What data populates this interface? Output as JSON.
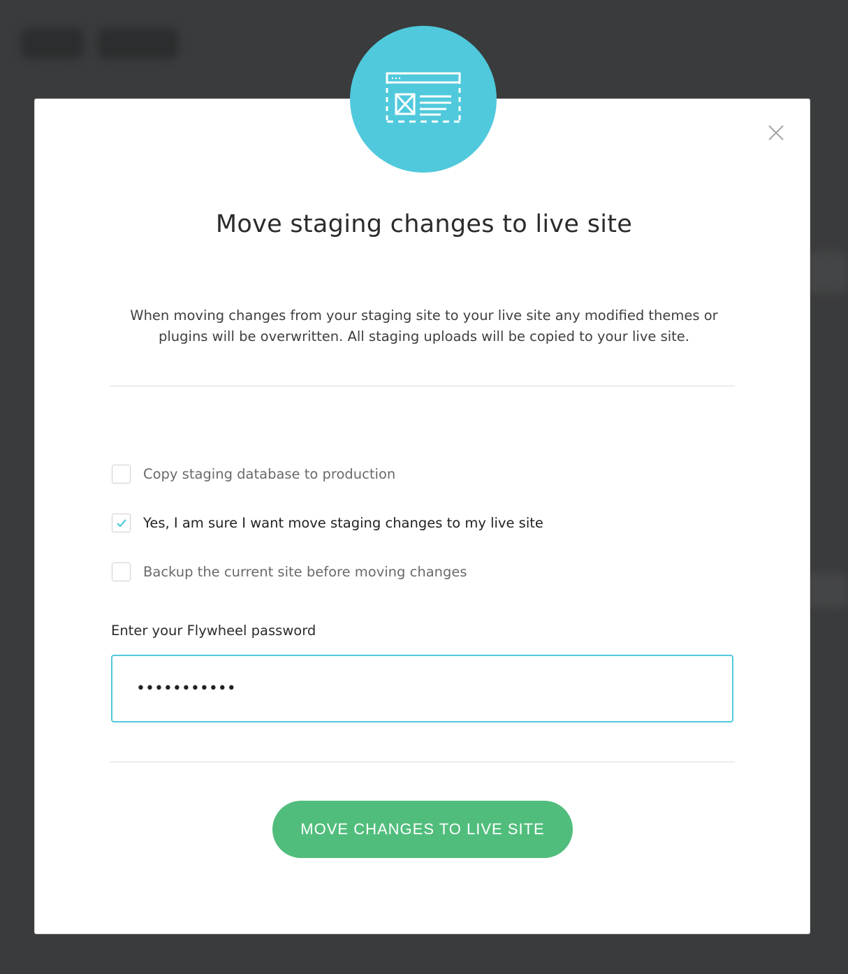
{
  "dialog": {
    "title": "Move staging changes to live site",
    "description": "When moving changes from your staging site to your live site any modified themes or plugins will be overwritten. All staging uploads will be copied to your live site.",
    "icon": "website-layout-icon",
    "close_icon": "close-icon"
  },
  "options": [
    {
      "label": "Copy staging database to production",
      "checked": false
    },
    {
      "label": "Yes, I am sure I want move staging changes to my live site",
      "checked": true
    },
    {
      "label": "Backup the current site before moving changes",
      "checked": false
    }
  ],
  "password": {
    "label": "Enter your Flywheel password",
    "value": "•••••••••••"
  },
  "submit": {
    "label": "MOVE CHANGES TO LIVE SITE"
  },
  "colors": {
    "accent": "#50c9dc",
    "primary_button": "#51bd7c",
    "overlay": "#3a3b3c"
  }
}
